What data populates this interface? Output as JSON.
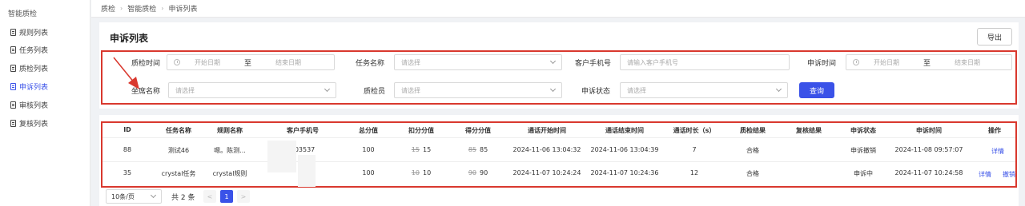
{
  "sidebar": {
    "title": "智能质检",
    "items": [
      {
        "label": "规则列表",
        "active": false
      },
      {
        "label": "任务列表",
        "active": false
      },
      {
        "label": "质检列表",
        "active": false
      },
      {
        "label": "申诉列表",
        "active": true
      },
      {
        "label": "审核列表",
        "active": false
      },
      {
        "label": "复核列表",
        "active": false
      }
    ]
  },
  "breadcrumb": [
    "质检",
    "智能质检",
    "申诉列表"
  ],
  "page": {
    "title": "申诉列表",
    "export_label": "导出"
  },
  "filters": {
    "qc_time": {
      "label": "质检时间",
      "start": "开始日期",
      "sep": "至",
      "end": "结束日期"
    },
    "task_name": {
      "label": "任务名称",
      "placeholder": "请选择"
    },
    "phone": {
      "label": "客户手机号",
      "placeholder": "请输入客户手机号"
    },
    "appeal_time": {
      "label": "申诉时间",
      "start": "开始日期",
      "sep": "至",
      "end": "结束日期"
    },
    "agent": {
      "label": "坐席名称",
      "placeholder": "请选择"
    },
    "inspector": {
      "label": "质检员",
      "placeholder": "请选择"
    },
    "status": {
      "label": "申诉状态",
      "placeholder": "请选择"
    },
    "search_label": "查询"
  },
  "table": {
    "headers": [
      "ID",
      "任务名称",
      "规则名称",
      "客户手机号",
      "总分值",
      "扣分分值",
      "得分分值",
      "通话开始时间",
      "通话结束时间",
      "通话时长（s）",
      "质检结果",
      "复核结果",
      "申诉状态",
      "申诉时间",
      "操作"
    ],
    "rows": [
      {
        "id": "88",
        "task": "测试46",
        "rule": "嗯。陈测...",
        "phone": "303537",
        "total": "100",
        "deduct_old": "15",
        "deduct": "15",
        "score_old": "85",
        "score": "85",
        "start": "2024-11-06 13:04:32",
        "end": "2024-11-06 13:04:39",
        "duration": "7",
        "result": "合格",
        "review": "",
        "status": "申诉撤销",
        "appeal_time": "2024-11-08 09:57:07",
        "actions": [
          "详情"
        ]
      },
      {
        "id": "35",
        "task": "crystal任务",
        "rule": "crystal规则",
        "phone": "1        3",
        "total": "100",
        "deduct_old": "10",
        "deduct": "10",
        "score_old": "90",
        "score": "90",
        "start": "2024-11-07 10:24:24",
        "end": "2024-11-07 10:24:36",
        "duration": "12",
        "result": "合格",
        "review": "",
        "status": "申诉中",
        "appeal_time": "2024-11-07 10:24:58",
        "actions": [
          "详情",
          "撤销"
        ]
      }
    ]
  },
  "pagination": {
    "page_size": "10条/页",
    "total": "共 2 条",
    "current": "1",
    "prev": "<",
    "next": ">"
  },
  "colors": {
    "accent": "#3a52e8",
    "highlight": "#d9382e"
  }
}
